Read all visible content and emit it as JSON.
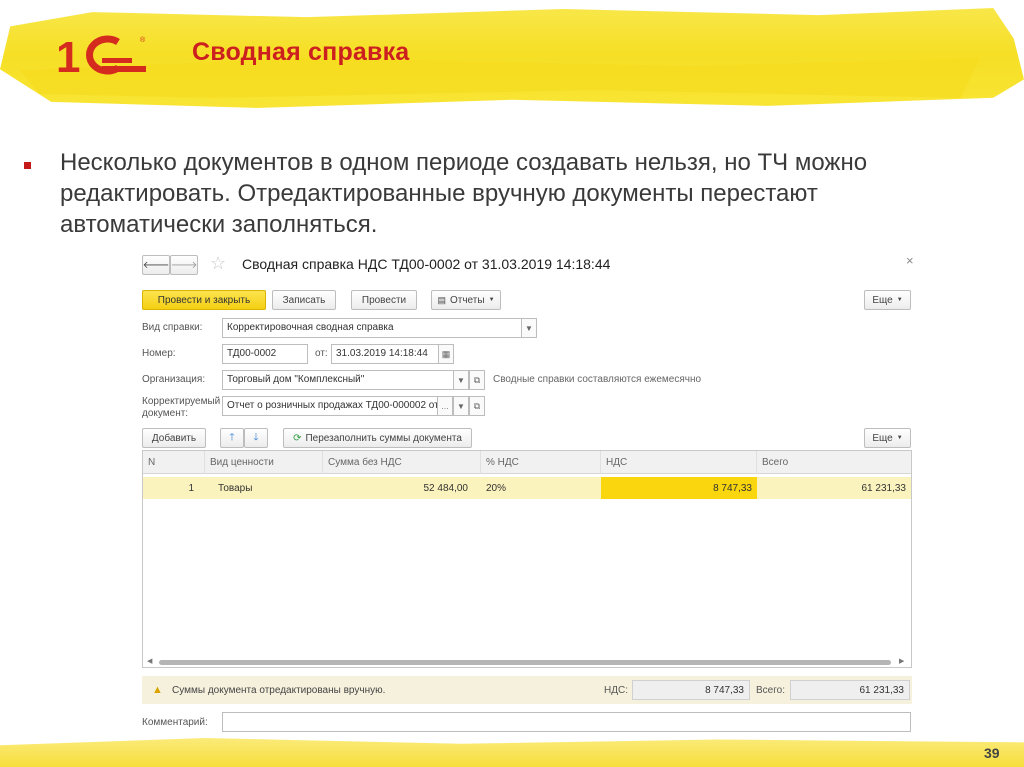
{
  "slide": {
    "title": "Сводная справка",
    "bullet": "Несколько документов в одном периоде создавать нельзя, но ТЧ можно редактировать. Отредактированные вручную документы перестают автоматически заполняться.",
    "page_number": "39",
    "logo_text": "1С"
  },
  "form": {
    "title": "Сводная справка НДС ТД00-0002 от 31.03.2019 14:18:44",
    "toolbar": {
      "post_close": "Провести и закрыть",
      "save": "Записать",
      "post": "Провести",
      "reports": "Отчеты",
      "more": "Еще"
    },
    "fields": {
      "type_label": "Вид справки:",
      "type_value": "Корректировочная сводная справка",
      "number_label": "Номер:",
      "number_value": "ТД00-0002",
      "date_label": "от:",
      "date_value": "31.03.2019 14:18:44",
      "org_label": "Организация:",
      "org_value": "Торговый дом \"Комплексный\"",
      "org_hint": "Сводные справки составляются ежемесячно",
      "corr_label_1": "Корректируемый",
      "corr_label_2": "документ:",
      "corr_value": "Отчет о розничных продажах ТД00-000002 от"
    },
    "table_toolbar": {
      "add": "Добавить",
      "refill": "Перезаполнить суммы документа",
      "more": "Еще"
    },
    "table": {
      "columns": [
        "N",
        "Вид ценности",
        "Сумма без НДС",
        "% НДС",
        "НДС",
        "Всего"
      ],
      "rows": [
        [
          "1",
          "Товары",
          "52 484,00",
          "20%",
          "8 747,33",
          "61 231,33"
        ]
      ]
    },
    "status": {
      "message": "Суммы документа отредактированы вручную.",
      "vat_label": "НДС:",
      "vat_value": "8 747,33",
      "total_label": "Всего:",
      "total_value": "61 231,33"
    },
    "comment_label": "Комментарий:"
  },
  "colors": {
    "accent_red": "#cc1f1f",
    "highlight_yellow": "#f6df25",
    "primary_button": "#f5cf12",
    "selected_cell": "#f9d60e"
  }
}
